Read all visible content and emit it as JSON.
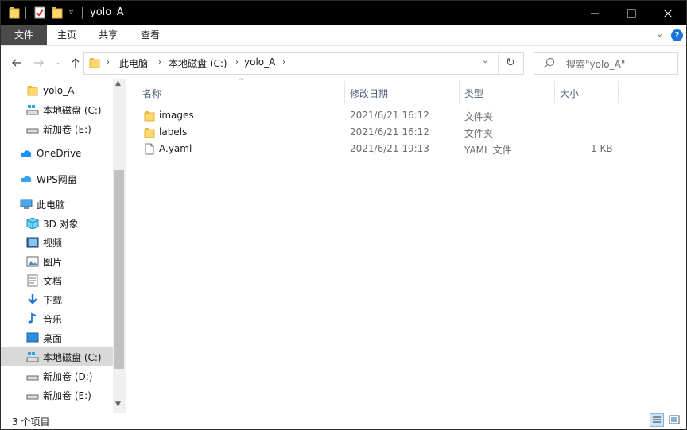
{
  "window": {
    "title": "yolo_A",
    "colors": {
      "titlebar": "#000000",
      "accent": "#0078d7",
      "file_tab": "#4a4a4a",
      "selected": "#d9d9d9"
    }
  },
  "ribbon": {
    "tabs": [
      "文件",
      "主页",
      "共享",
      "查看"
    ]
  },
  "address": {
    "crumbs": [
      "此电脑",
      "本地磁盘 (C:)",
      "yolo_A"
    ]
  },
  "search": {
    "placeholder": "搜索\"yolo_A\""
  },
  "sidebar": {
    "items": [
      {
        "label": "yolo_A",
        "icon": "folder-icon"
      },
      {
        "label": "本地磁盘 (C:)",
        "icon": "drive-icon"
      },
      {
        "label": "新加卷 (E:)",
        "icon": "drive-icon"
      },
      {
        "label": "OneDrive",
        "icon": "cloud-icon"
      },
      {
        "label": "WPS网盘",
        "icon": "wps-cloud-icon"
      },
      {
        "label": "此电脑",
        "icon": "computer-icon"
      },
      {
        "label": "3D 对象",
        "icon": "cube-icon"
      },
      {
        "label": "视频",
        "icon": "video-icon"
      },
      {
        "label": "图片",
        "icon": "picture-icon"
      },
      {
        "label": "文档",
        "icon": "document-icon"
      },
      {
        "label": "下载",
        "icon": "download-icon"
      },
      {
        "label": "音乐",
        "icon": "music-icon"
      },
      {
        "label": "桌面",
        "icon": "desktop-icon"
      },
      {
        "label": "本地磁盘 (C:)",
        "icon": "drive-icon"
      },
      {
        "label": "新加卷 (D:)",
        "icon": "drive-icon"
      },
      {
        "label": "新加卷 (E:)",
        "icon": "drive-icon"
      }
    ]
  },
  "columns": {
    "name": "名称",
    "date": "修改日期",
    "type": "类型",
    "size": "大小"
  },
  "files": [
    {
      "name": "images",
      "date": "2021/6/21 16:12",
      "type": "文件夹",
      "size": "",
      "icon": "folder-icon"
    },
    {
      "name": "labels",
      "date": "2021/6/21 16:12",
      "type": "文件夹",
      "size": "",
      "icon": "folder-icon"
    },
    {
      "name": "A.yaml",
      "date": "2021/6/21 19:13",
      "type": "YAML 文件",
      "size": "1 KB",
      "icon": "file-icon"
    }
  ],
  "status": {
    "count": "3 个项目"
  }
}
